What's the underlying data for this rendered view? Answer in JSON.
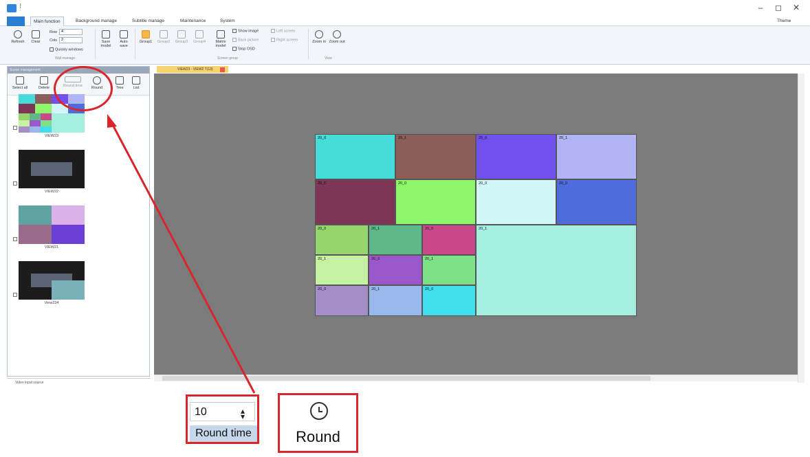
{
  "window": {
    "min": "–",
    "max": "◻",
    "close": "✕",
    "theme": "Theme"
  },
  "tabs": [
    "Main function",
    "Background manage",
    "Subtitle manage",
    "Maintenance",
    "System"
  ],
  "ribbon": {
    "refresh": "Refresh",
    "clear": "Clear",
    "row_label": "Row",
    "row_value": "4",
    "cols_label": "Cols",
    "cols_value": "2",
    "quickly_windows": "Quickly windows",
    "group_wall": "Wall manage",
    "save_model": "Save model",
    "auto_save": "Auto save",
    "group1": "Group1",
    "group2": "Group2",
    "group3": "Group3",
    "group4": "Group4",
    "matrix_model": "Matrix model",
    "show_image": "Show image",
    "back_picture": "Back picture",
    "stop_osd": "Stop OSD",
    "left_screen": "Left screen",
    "right_screen": "Right screen",
    "screen_group": "Screen group",
    "zoom_in": "Zoom in",
    "zoom_out": "Zoom out",
    "view": "View"
  },
  "left_panel": {
    "header": "Scene management",
    "select_all": "Select all",
    "delete": "Delete",
    "round_time_value": "10",
    "round_time": "Round time",
    "round": "Round",
    "tree": "Tree",
    "list": "List",
    "scenes": [
      "VIEW23",
      "VIEW22",
      "VIEW21",
      "View234"
    ],
    "footer": "Video input source"
  },
  "doc_tab": "VIEW23 - VIEW2 T(13)",
  "wall_cells": [
    {
      "label": "20_0",
      "color": "#48dcd8"
    },
    {
      "label": "20_1",
      "color": "#8c5e59"
    },
    {
      "label": "20_0",
      "color": "#7150ed"
    },
    {
      "label": "20_1",
      "color": "#b0b4f4"
    },
    {
      "label": "20_0",
      "color": "#7e3556"
    },
    {
      "label": "20_0",
      "color": "#8ef66a"
    },
    {
      "label": "20_0",
      "color": "#d2f7f9"
    },
    {
      "label": "20_0",
      "color": "#4e6cdc"
    },
    {
      "label": "20_0",
      "color": "#96d46c"
    },
    {
      "label": "20_1",
      "color": "#5fb88a"
    },
    {
      "label": "20_0",
      "color": "#c84a8a"
    },
    {
      "label": "20_1",
      "color": "#a6eee0"
    },
    {
      "label": "20_1",
      "color": "#c6f0a2"
    },
    {
      "label": "20_0",
      "color": "#9b57c9"
    },
    {
      "label": "20_1",
      "color": "#7fe08a"
    },
    {
      "label": "20_0",
      "color": "#a48ec8"
    },
    {
      "label": "20_1",
      "color": "#98b8ec"
    },
    {
      "label": "20_0",
      "color": "#3ee0ee"
    }
  ],
  "callouts": {
    "round_time_value": "10",
    "round_time_label": "Round time",
    "round_label": "Round",
    "accent": "#d9262c"
  }
}
